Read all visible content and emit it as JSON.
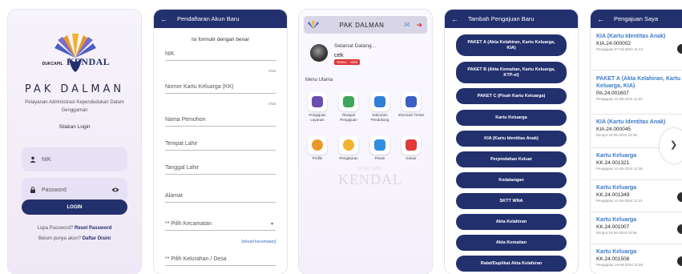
{
  "login": {
    "logo_small": "DUKCAPIL",
    "logo_big": "KENDAL",
    "app_name": "PAK DALMAN",
    "subtitle": "Pelayanan Administrasi Kependudukan Dalam Genggaman",
    "title": "Silakan Login",
    "nik_placeholder": "NIK",
    "password_placeholder": "Password",
    "login_label": "LOGIN",
    "forgot_prefix": "Lupa Password?",
    "forgot_link": "Reset Password",
    "register_prefix": "Belum punya akun?",
    "register_link": "Daftar Disini"
  },
  "register": {
    "title": "Pendaftaran Akun Baru",
    "intro": "Isi formulir dengan benar",
    "fields": [
      "NIK",
      "Nomor Kartu Keluarga (KK)",
      "Nama Pemohon",
      "Tempat Lahir",
      "Tanggal Lahir",
      "Alamat",
      "** Pilih Kecamatan",
      "** Pilih Kelurahan / Desa"
    ],
    "counter1": "0/16",
    "counter2": "0/16",
    "reload_label": "[reload kecamatan]"
  },
  "menu": {
    "title": "PAK DALMAN",
    "greeting": "Selamat Datang...",
    "username": "cek",
    "status": "Status : Valid",
    "section_label": "Menu Utama",
    "items": [
      {
        "label": "Pengajuan Layanan",
        "color": "#6a4fb0"
      },
      {
        "label": "Riwayat Pengajuan",
        "color": "#3fa55b"
      },
      {
        "label": "Dokumen Pendukung",
        "color": "#2f7fd8"
      },
      {
        "label": "Informasi Terkini",
        "color": "#3d5fc4"
      },
      {
        "label": "Profile",
        "color": "#e8982a"
      },
      {
        "label": "Pengaturan",
        "color": "#f2b230"
      },
      {
        "label": "Pesan",
        "color": "#2f8fe0"
      },
      {
        "label": "Keluar",
        "color": "#e03a3a"
      }
    ],
    "watermark_top": "DUKCAPIL",
    "watermark_big": "KENDAL"
  },
  "paket": {
    "title": "Tambah Pengajuan Baru",
    "buttons": [
      "PAKET A (Akta Kelahiran, Kartu Keluarga, KIA)",
      "PAKET B (Akta Kematian, Kartu Keluarga, KTP-el)",
      "PAKET C (Pisah Kartu Keluarga)",
      "Kartu Keluarga",
      "KIA (Kartu Identitas Anak)",
      "Perpindahan Keluar",
      "Kedatangan",
      "SKTT WNA",
      "Akta Kelahiran",
      "Akta Kematian",
      "Ralat/Duplikat Akta Kelahiran"
    ]
  },
  "pengajuan": {
    "title": "Pengajuan Saya",
    "items": [
      {
        "title": "KIA (Kartu Identitas Anak)",
        "number": "KIA.24.000002",
        "date": "Pengajuan 07-03-2024 11:44"
      },
      {
        "title": "PAKET A (Akta Kelahiran, Kartu Keluarga, KIA)",
        "number": "PA.24.001607",
        "date": "Pengajuan 11-06-2024 11:20"
      },
      {
        "title": "KIA (Kartu Identitas Anak)",
        "number": "KIA.24.000045",
        "date": "Diinput 10-05-2024 22:39"
      },
      {
        "title": "Kartu Keluarga",
        "number": "KK.24.001321",
        "date": "Pengajuan 11-06-2024 11:38"
      },
      {
        "title": "Kartu Keluarga",
        "number": "KK.24.001349",
        "date": "Pengajuan 11-06-2024 11:21"
      },
      {
        "title": "Kartu Keluarga",
        "number": "KK.24.001007",
        "date": "Diinput 10-06-2024 04:56"
      },
      {
        "title": "Kartu Keluarga",
        "number": "KK.24.001508",
        "date": "Pengajuan 19-06-2024 11:59"
      }
    ]
  }
}
